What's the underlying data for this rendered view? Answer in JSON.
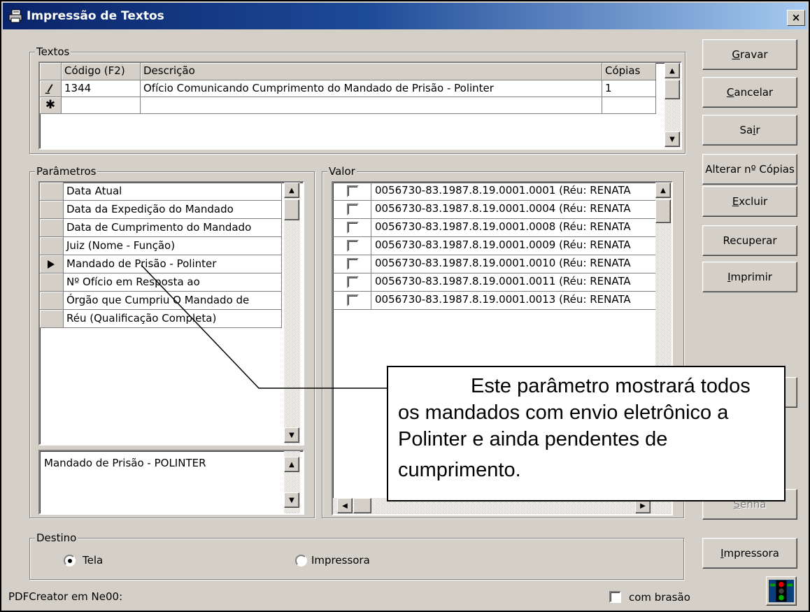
{
  "window": {
    "title": "Impressão de Textos",
    "close_label": "×"
  },
  "textos": {
    "group_label": "Textos",
    "columns": [
      "Código (F2)",
      "Descrição",
      "Cópias"
    ],
    "rows": [
      {
        "marker": "pencil",
        "codigo": "1344",
        "descricao": "Ofício Comunicando Cumprimento do Mandado de Prisão - Polinter",
        "copias": "1"
      },
      {
        "marker": "asterisk",
        "codigo": "",
        "descricao": "",
        "copias": ""
      }
    ],
    "new_row_marker": "✱"
  },
  "parametros": {
    "group_label": "Parâmetros",
    "items": [
      "Data Atual",
      "Data da Expedição do Mandado",
      "Data de Cumprimento do Mandado",
      "Juiz (Nome - Função)",
      "Mandado de Prisão - Polinter",
      "Nº Ofício em Resposta ao",
      "Órgão que Cumpriu O Mandado de",
      "Réu (Qualificação Completa)"
    ],
    "selected_index": 4,
    "description": "Mandado de Prisão - POLINTER"
  },
  "valor": {
    "group_label": "Valor",
    "items": [
      "0056730-83.1987.8.19.0001.0001 (Réu: RENATA",
      "0056730-83.1987.8.19.0001.0004 (Réu: RENATA",
      "0056730-83.1987.8.19.0001.0008 (Réu: RENATA",
      "0056730-83.1987.8.19.0001.0009 (Réu: RENATA",
      "0056730-83.1987.8.19.0001.0010 (Réu: RENATA",
      "0056730-83.1987.8.19.0001.0011 (Réu: RENATA",
      "0056730-83.1987.8.19.0001.0013 (Réu: RENATA"
    ]
  },
  "buttons": {
    "gravar": {
      "accel": "G",
      "rest": "ravar"
    },
    "cancelar": {
      "accel": "C",
      "rest": "ancelar"
    },
    "sair": {
      "pre": "Sa",
      "accel": "i",
      "rest": "r"
    },
    "alterar": "Alterar nº Cópias",
    "excluir": {
      "accel": "E",
      "rest": "xcluir"
    },
    "recuperar": "Recuperar",
    "imprimir": {
      "accel": "I",
      "rest": "mprimir"
    },
    "senha": {
      "accel": "S",
      "rest": "enha"
    },
    "impressora": {
      "accel": "I",
      "rest": "mpressora"
    }
  },
  "destino": {
    "group_label": "Destino",
    "options": [
      {
        "label": "Tela",
        "selected": true
      },
      {
        "label": "Impressora",
        "selected": false
      }
    ]
  },
  "status": {
    "printer_text": "PDFCreator em Ne00:",
    "brasao_label": "com brasão",
    "brasao_checked": false
  },
  "callout": {
    "line1": "Este parâmetro mostrará todos",
    "line2": "os mandados com envio eletrônico a",
    "line3": "Polinter e ainda pendentes de",
    "line4": "cumprimento."
  },
  "icons": {
    "title": "printer-doc-icon",
    "status": "traffic-light-icon"
  },
  "colors": {
    "titlebar_start": "#0a246a",
    "titlebar_end": "#a6caf0",
    "face": "#d4d0c8",
    "shadow": "#808080"
  }
}
